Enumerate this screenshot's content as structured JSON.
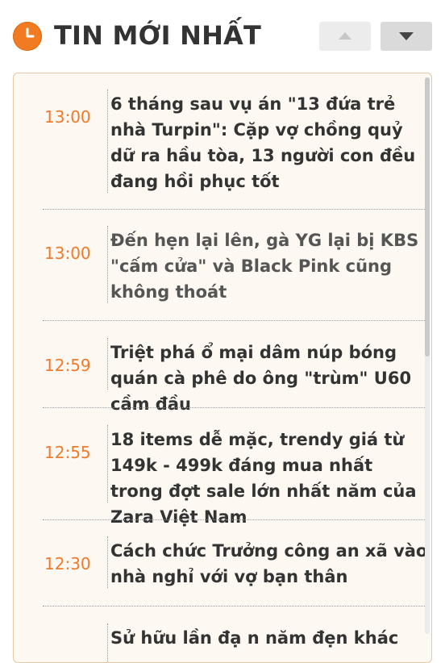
{
  "header": {
    "title": "TIN MỚI NHẤT",
    "icon": "clock-icon",
    "up_icon": "chevron-up-icon",
    "down_icon": "chevron-down-icon",
    "accent_color": "#f07b22"
  },
  "news": [
    {
      "time": "13:00",
      "headline": "6 tháng sau vụ án \"13 đứa trẻ nhà Turpin\": Cặp vợ chồng quỷ dữ ra hầu tòa, 13 người con đều đang hồi phục tốt"
    },
    {
      "time": "13:00",
      "headline": "Đến hẹn lại lên, gà YG lại bị KBS \"cấm cửa\" và Black Pink cũng không thoát"
    },
    {
      "time": "12:59",
      "headline": "Triệt phá ổ mại dâm núp bóng quán cà phê do ông \"trùm\" U60 cầm đầu"
    },
    {
      "time": "12:55",
      "headline": "18 items dễ mặc, trendy giá từ 149k - 499k đáng mua nhất trong đợt sale lớn nhất năm của Zara Việt Nam"
    },
    {
      "time": "12:30",
      "headline": "Cách chức Trưởng công an xã vào nhà nghỉ với vợ bạn thân"
    },
    {
      "time": "",
      "headline": "Sử hữu lần đạ n năm đẹn khác"
    }
  ]
}
